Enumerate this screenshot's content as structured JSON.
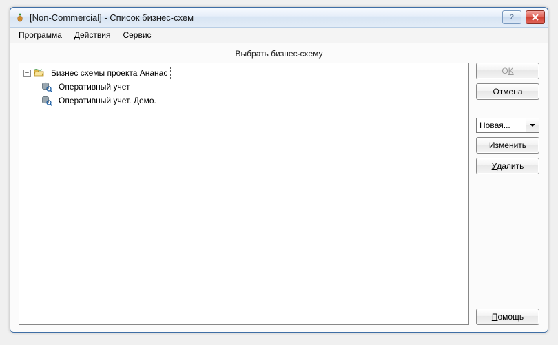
{
  "titlebar": {
    "title": "[Non-Commercial] - Список бизнес-схем"
  },
  "menu": {
    "program": "Программа",
    "actions": "Действия",
    "service": "Сервис"
  },
  "subtitle": "Выбрать бизнес-схему",
  "tree": {
    "root_label": "Бизнес схемы проекта Ананас",
    "items": [
      {
        "label": "Оперативный учет"
      },
      {
        "label": "Оперативный учет. Демо."
      }
    ]
  },
  "buttons": {
    "ok_pre": "O",
    "ok_ul": "K",
    "cancel": "Отмена",
    "change_ul": "И",
    "change_rest": "зменить",
    "delete_ul": "У",
    "delete_rest": "далить",
    "help_ul": "П",
    "help_rest": "омощь"
  },
  "combo": {
    "selected": "Новая..."
  },
  "icons": {
    "app": "pineapple-icon",
    "help": "help-icon",
    "close": "close-icon",
    "expander": "−",
    "folder": "folder-open-icon",
    "db": "database-search-icon",
    "dropdown": "chevron-down-icon"
  }
}
